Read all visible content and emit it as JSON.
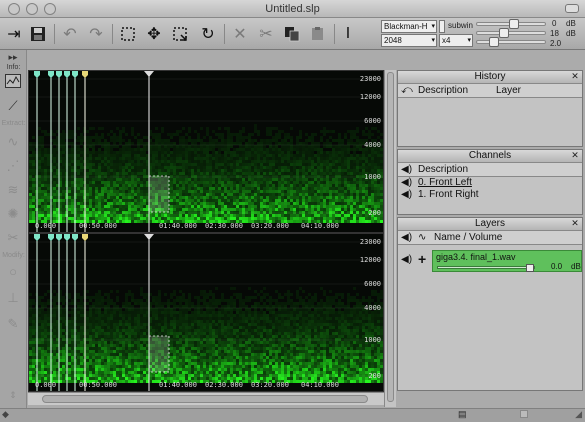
{
  "window": {
    "title": "Untitled.slp"
  },
  "toolbar": {
    "window_select": "Blackman-H",
    "window_size": "2048",
    "subwin_label": "subwin",
    "overlap": "x4",
    "gain_top": "0",
    "gain_mid": "18",
    "gain_db": "dB",
    "gain_bottom": "2.0"
  },
  "palette": {
    "info_label": "Info:",
    "extract_label": "Extract:",
    "modify_label": "Modify:"
  },
  "spectrogram": {
    "freq_labels": [
      "23000",
      "12000",
      "6000",
      "4000",
      "1000",
      "200"
    ],
    "time_labels": [
      "0.000",
      "00:50.000",
      "01:40.000",
      "02:30.000",
      "03:20.000",
      "04:10.000"
    ]
  },
  "history": {
    "title": "History",
    "col_description": "Description",
    "col_layer": "Layer"
  },
  "channels": {
    "title": "Channels",
    "col_description": "Description",
    "items": [
      "0. Front Left",
      "1. Front Right"
    ]
  },
  "layers": {
    "title": "Layers",
    "col_name": "Name / Volume",
    "items": [
      {
        "name": "giga3.4. final_1.wav",
        "volume": "0.0",
        "unit": "dB"
      }
    ]
  },
  "colors": {
    "accent_green": "#5fc05c",
    "spectro_green": "#2ecc2e"
  }
}
